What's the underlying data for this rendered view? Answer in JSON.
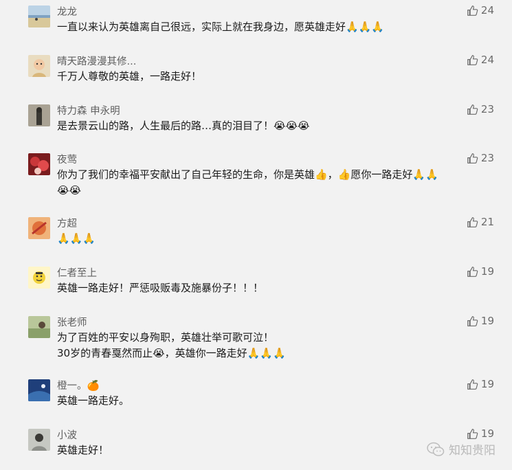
{
  "comments": [
    {
      "name": "龙龙",
      "likes": "24",
      "text": "一直以来认为英雄离自己很远，实际上就在我身边，愿英雄走好🙏🙏🙏",
      "avatar_color": "#7fa2c2"
    },
    {
      "name": "晴天路漫漫其修...",
      "likes": "24",
      "text": "千万人尊敬的英雄，一路走好！",
      "avatar_color": "#d9b77b"
    },
    {
      "name": "特力森  申永明",
      "likes": "23",
      "text": "是去景云山的路，人生最后的路…真的泪目了！😭😭😭",
      "avatar_color": "#6f6a60"
    },
    {
      "name": "夜莺",
      "likes": "23",
      "text": "你为了我们的幸福平安献出了自己年轻的生命，你是英雄👍，👍愿你一路走好🙏🙏\n😭😭",
      "avatar_color": "#c9383a"
    },
    {
      "name": "方超",
      "likes": "21",
      "text": "🙏🙏🙏",
      "avatar_color": "#e0703a"
    },
    {
      "name": "仁者至上",
      "likes": "19",
      "text": "英雄一路走好！严惩吸贩毒及施暴份子！！！",
      "avatar_color": "#f2d23a"
    },
    {
      "name": "张老师",
      "likes": "19",
      "text": "为了百姓的平安以身殉职，英雄壮举可歌可泣！\n30岁的青春戛然而止😭，英雄你一路走好🙏🙏🙏",
      "avatar_color": "#8aa06a"
    },
    {
      "name": "橙一。🍊",
      "likes": "19",
      "text": "英雄一路走好。",
      "avatar_color": "#3a6fb0"
    },
    {
      "name": "小波",
      "likes": "19",
      "text": "英雄走好！",
      "avatar_color": "#8d8f8a"
    }
  ],
  "watermark": "知知贵阳"
}
